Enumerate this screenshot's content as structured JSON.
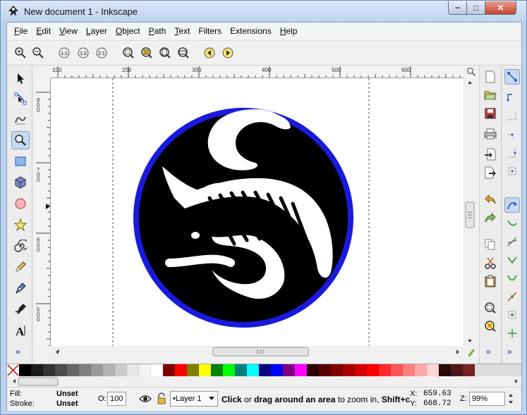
{
  "window": {
    "title": "New document 1 - Inkscape",
    "controls": {
      "minimize": "−",
      "maximize": "□",
      "close": "✕"
    }
  },
  "menu": [
    {
      "label": "File",
      "u": "F",
      "rest": "ile"
    },
    {
      "label": "Edit",
      "u": "E",
      "rest": "dit"
    },
    {
      "label": "View",
      "u": "V",
      "rest": "iew"
    },
    {
      "label": "Layer",
      "u": "L",
      "rest": "ayer"
    },
    {
      "label": "Object",
      "u": "O",
      "rest": "bject"
    },
    {
      "label": "Path",
      "u": "P",
      "rest": "ath"
    },
    {
      "label": "Text",
      "u": "T",
      "rest": "ext"
    },
    {
      "label": "Filters",
      "u": "",
      "rest": "Filters"
    },
    {
      "label": "Extensions",
      "u": "",
      "rest": "Extensions"
    },
    {
      "label": "Help",
      "u": "H",
      "rest": "elp"
    }
  ],
  "zoom_toolbar": {
    "icons": [
      "zoom-in-icon",
      "zoom-out-icon",
      "zoom-1-1-icon",
      "zoom-1-2-icon",
      "zoom-2-1-icon",
      "zoom-selection-icon",
      "zoom-drawing-icon",
      "zoom-page-icon",
      "zoom-page-width-icon",
      "zoom-previous-icon",
      "zoom-next-icon"
    ],
    "labels": {
      "zoom_1_1": "1:1",
      "zoom_1_2": "1:2",
      "zoom_2_1": "2:1"
    }
  },
  "tools": [
    "selector-tool",
    "node-tool",
    "tweak-tool",
    "zoom-tool",
    "rectangle-tool",
    "3d-box-tool",
    "ellipse-tool",
    "star-tool",
    "spiral-tool",
    "pencil-tool",
    "pen-tool",
    "calligraphy-tool",
    "text-tool"
  ],
  "active_tool": "zoom-tool",
  "more_glyph": "»",
  "ruler": {
    "h_labels": [
      "100",
      "200",
      "300",
      "400",
      "500",
      "600"
    ],
    "v_labels": [
      "800",
      "700",
      "600",
      "500"
    ]
  },
  "commands_right": [
    "new-document",
    "open-document",
    "save-document",
    "print-document",
    "import",
    "export",
    "undo",
    "redo",
    "copy",
    "cut",
    "paste",
    "zoom-selection",
    "zoom-drawing"
  ],
  "snap_controls": [
    "snap-enable",
    "snap-bbox",
    "snap-bbox-edges",
    "snap-bbox-corners",
    "snap-bbox-midpoints",
    "snap-bbox-centers",
    "snap-nodes",
    "snap-paths",
    "snap-path-intersections",
    "snap-cusp-nodes",
    "snap-smooth-nodes",
    "snap-midpoints",
    "snap-centers",
    "snap-rotation-center"
  ],
  "palette": {
    "colors": [
      "#000000",
      "#1a1a1a",
      "#333333",
      "#4d4d4d",
      "#666666",
      "#808080",
      "#999999",
      "#b3b3b3",
      "#cccccc",
      "#e6e6e6",
      "#f2f2f2",
      "#ffffff",
      "#800000",
      "#ff0000",
      "#808000",
      "#ffff00",
      "#008000",
      "#00ff00",
      "#008080",
      "#00ffff",
      "#000080",
      "#0000ff",
      "#800080",
      "#ff00ff",
      "#2b0000",
      "#550000",
      "#800000",
      "#aa0000",
      "#d40000",
      "#ff0000",
      "#ff2a2a",
      "#ff5555",
      "#ff8080",
      "#ffaaaa",
      "#ffd5d5",
      "#280b0b",
      "#501616",
      "#782121"
    ]
  },
  "status": {
    "fill_label": "Fill:",
    "fill_value": "Unset",
    "stroke_label": "Stroke:",
    "stroke_value": "Unset",
    "opacity_label": "O:",
    "opacity_value": "100",
    "layer_name": "•Layer 1",
    "message_bold1": "Click",
    "message_mid1": " or ",
    "message_bold2": "drag around an area",
    "message_mid2": " to zoom in, ",
    "message_bold3": "Shift+cl",
    "x_label": "X:",
    "x_value": "659.63",
    "y_label": "Y:",
    "y_value": "668.72",
    "zoom_label": "Z:",
    "zoom_value": "99%"
  },
  "colors": {
    "circle_stroke": "#1a1add",
    "circle_fill": "#000000",
    "glyph_fill": "#ffffff"
  }
}
